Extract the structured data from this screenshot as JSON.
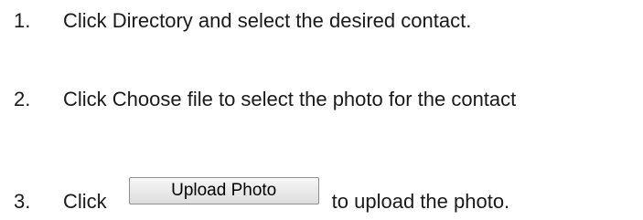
{
  "steps": [
    {
      "number": "1.",
      "text": "Click Directory and select the desired contact."
    },
    {
      "number": "2.",
      "text": "Click Choose file to select the photo for the contact"
    },
    {
      "number": "3.",
      "before": "Click",
      "button_label": "Upload Photo",
      "after": "to upload the photo."
    }
  ]
}
